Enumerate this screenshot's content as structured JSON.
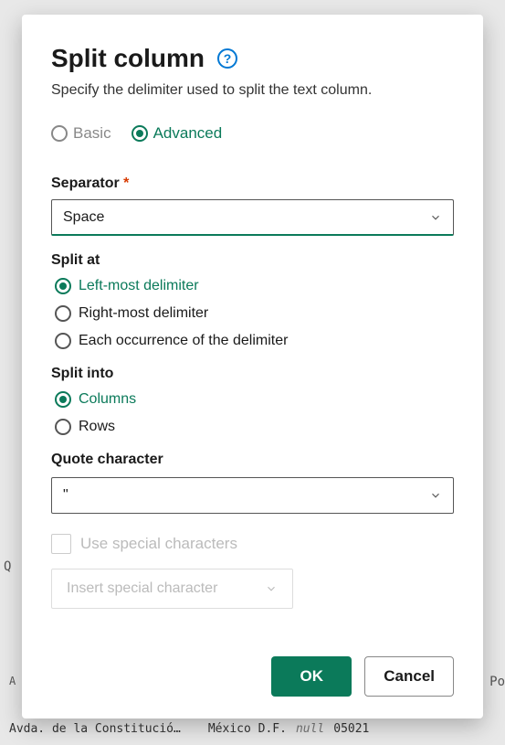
{
  "dialog": {
    "title": "Split column",
    "subtitle": "Specify the delimiter used to split the text column.",
    "mode": {
      "basic_label": "Basic",
      "advanced_label": "Advanced",
      "selected": "advanced"
    },
    "separator": {
      "label": "Separator",
      "required_mark": "*",
      "value": "Space"
    },
    "split_at": {
      "label": "Split at",
      "options": {
        "left": "Left-most delimiter",
        "right": "Right-most delimiter",
        "each": "Each occurrence of the delimiter"
      },
      "selected": "left"
    },
    "split_into": {
      "label": "Split into",
      "options": {
        "columns": "Columns",
        "rows": "Rows"
      },
      "selected": "columns"
    },
    "quote_char": {
      "label": "Quote character",
      "value": "\""
    },
    "special": {
      "checkbox_label": "Use special characters",
      "insert_label": "Insert special character"
    },
    "footer": {
      "ok_label": "OK",
      "cancel_label": "Cancel"
    }
  },
  "background": {
    "q_label": "Q",
    "a_label": "A",
    "po_label": "Po",
    "row_address": "Avda. de la Constitució…",
    "row_city": "México D.F.",
    "row_null": "null",
    "row_code": "05021"
  }
}
